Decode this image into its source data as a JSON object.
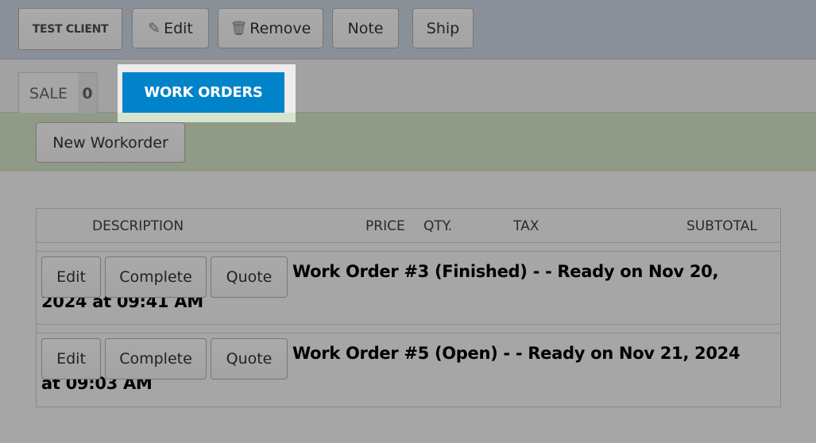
{
  "toolbar": {
    "client": "TEST CLIENT",
    "edit": "Edit",
    "remove": "Remove",
    "note": "Note",
    "ship": "Ship"
  },
  "tabs": {
    "sale_label": "SALE",
    "sale_count": "0",
    "work_orders": "WORK ORDERS"
  },
  "actions": {
    "new_workorder": "New Workorder"
  },
  "table": {
    "headers": [
      "DESCRIPTION",
      "PRICE",
      "QTY.",
      "TAX",
      "SUBTOTAL"
    ],
    "rows": [
      {
        "edit": "Edit",
        "complete": "Complete",
        "quote": "Quote",
        "description": "Work Order #3 (Finished) - - Ready on Nov 20, 2024 at 09:41 AM"
      },
      {
        "edit": "Edit",
        "complete": "Complete",
        "quote": "Quote",
        "description": "Work Order #5 (Open) - - Ready on Nov 21, 2024 at 09:03 AM"
      }
    ]
  },
  "colors": {
    "accent": "#0083c9"
  }
}
